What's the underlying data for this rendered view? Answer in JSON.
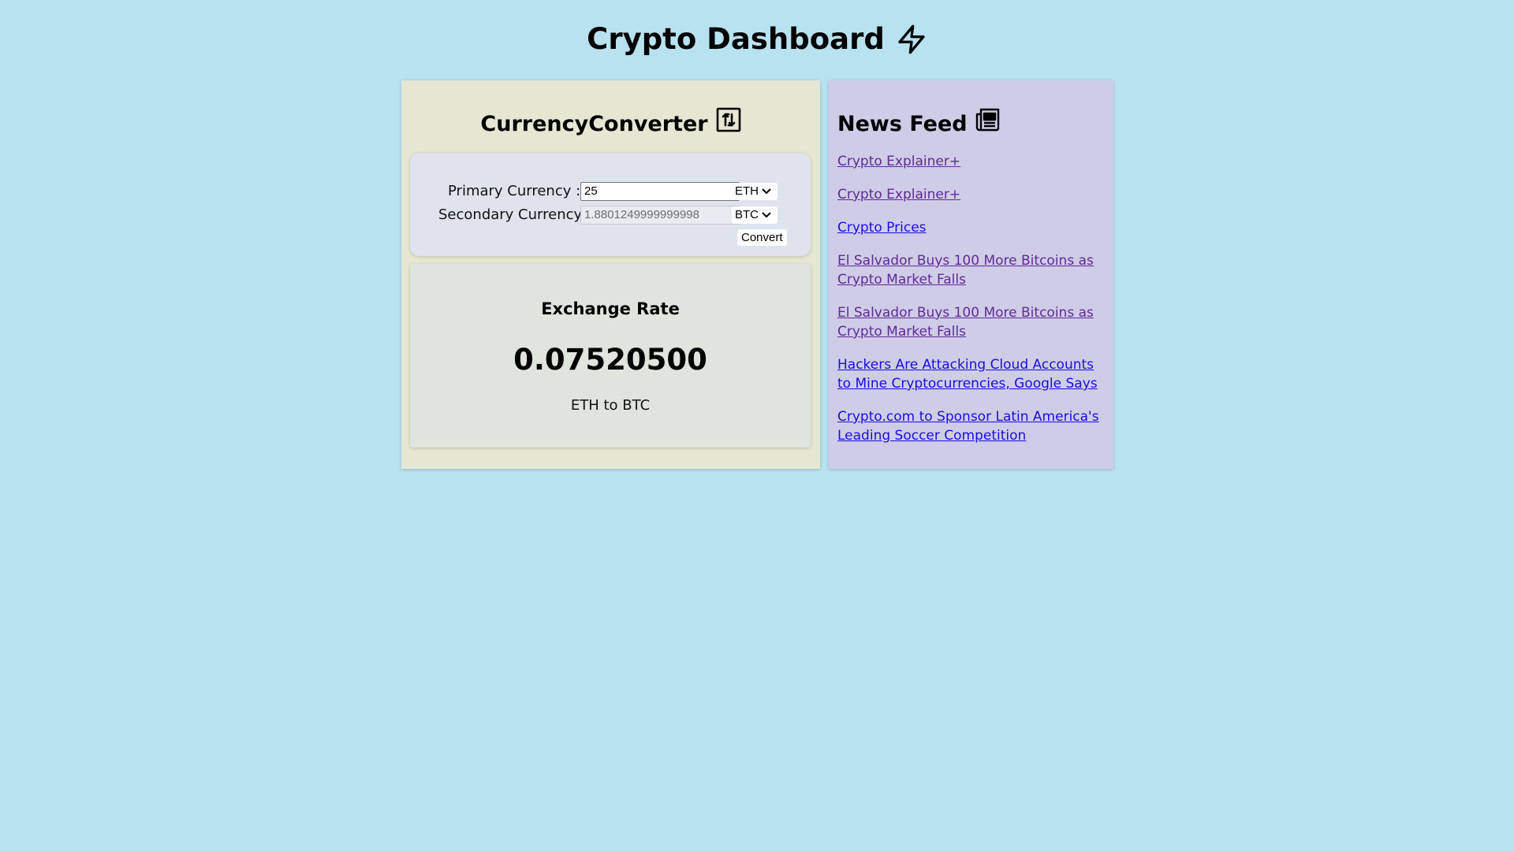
{
  "header": {
    "title": "Crypto Dashboard",
    "icon": "lightning-bolt-icon"
  },
  "converter": {
    "title": "CurrencyConverter",
    "icon": "swap-arrows-icon",
    "primary": {
      "label": "Primary Currency :",
      "value": "25",
      "currency": "ETH"
    },
    "secondary": {
      "label": "Secondary Currency :",
      "value": "1.8801249999999998",
      "currency": "BTC"
    },
    "convert_label": "Convert"
  },
  "exchange": {
    "title": "Exchange Rate",
    "rate": "0.07520500",
    "pair": "ETH to BTC"
  },
  "news": {
    "title": "News Feed",
    "icon": "newspaper-icon",
    "items": [
      {
        "title": "Crypto Explainer+",
        "visited": true
      },
      {
        "title": "Crypto Explainer+",
        "visited": true
      },
      {
        "title": "Crypto Prices",
        "visited": false
      },
      {
        "title": "El Salvador Buys 100 More Bitcoins as Crypto Market Falls",
        "visited": true
      },
      {
        "title": "El Salvador Buys 100 More Bitcoins as Crypto Market Falls",
        "visited": true
      },
      {
        "title": "Hackers Are Attacking Cloud Accounts to Mine Cryptocurrencies, Google Says",
        "visited": false
      },
      {
        "title": "Crypto.com to Sponsor Latin America's Leading Soccer Competition",
        "visited": false
      }
    ]
  },
  "colors": {
    "background": "#b8e2ef",
    "converter_panel": "#e6e7d3",
    "news_panel": "#cfcce8",
    "visited_link": "#5f2a94",
    "link": "#1a0ddc"
  }
}
